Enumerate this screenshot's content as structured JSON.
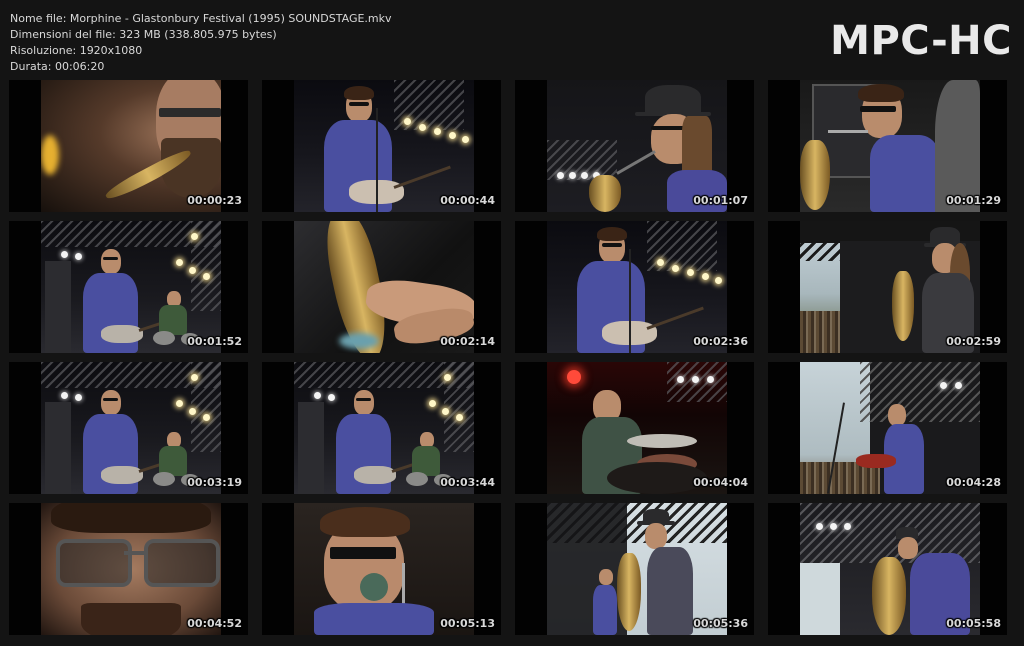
{
  "info": {
    "file_name": "Nome file: Morphine - Glastonbury Festival (1995) SOUNDSTAGE.mkv",
    "file_size": "Dimensioni del file: 323 MB (338.805.975 bytes)",
    "resolution": "Risoluzione: 1920x1080",
    "duration": "Durata: 00:06:20"
  },
  "brand": "MPC-HC",
  "thumbnails": [
    {
      "time": "00:00:23",
      "scene": "sax-closeup"
    },
    {
      "time": "00:00:44",
      "scene": "guitarist-stage"
    },
    {
      "time": "00:01:07",
      "scene": "hat-sax"
    },
    {
      "time": "00:01:29",
      "scene": "singer-closeup"
    },
    {
      "time": "00:01:52",
      "scene": "wide-stage"
    },
    {
      "time": "00:02:14",
      "scene": "hand-sax"
    },
    {
      "time": "00:02:36",
      "scene": "guitarist-stage"
    },
    {
      "time": "00:02:59",
      "scene": "hat-sax-side"
    },
    {
      "time": "00:03:19",
      "scene": "wide-stage"
    },
    {
      "time": "00:03:44",
      "scene": "wide-stage"
    },
    {
      "time": "00:04:04",
      "scene": "drummer"
    },
    {
      "time": "00:04:28",
      "scene": "sky-bass"
    },
    {
      "time": "00:04:52",
      "scene": "face-closeup"
    },
    {
      "time": "00:05:13",
      "scene": "singer-mic"
    },
    {
      "time": "00:05:36",
      "scene": "hat-sax-stand"
    },
    {
      "time": "00:05:58",
      "scene": "sax-stage-right"
    }
  ]
}
